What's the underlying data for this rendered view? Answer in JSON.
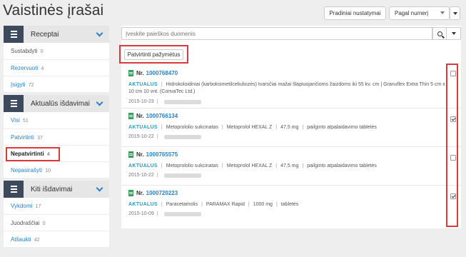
{
  "page": {
    "title": "Vaistinės įrašai"
  },
  "toolbar": {
    "reset_label": "Pradiniai nustatymai",
    "sort_label": "Pagal numerį"
  },
  "search": {
    "placeholder": "Įveskite paieškos duomenis"
  },
  "selected_button": {
    "label": "Patvirtinti pažymėtus"
  },
  "sidebar": {
    "recipes": {
      "title": "Receptai",
      "items": [
        {
          "label": "Sustabdyti",
          "count": "0"
        },
        {
          "label": "Rezervuoti",
          "count": "4"
        },
        {
          "label": "Įsigyti",
          "count": "72"
        }
      ]
    },
    "current": {
      "title": "Aktualūs išdavimai",
      "items": [
        {
          "label": "Visi",
          "count": "51"
        },
        {
          "label": "Patvirtinti",
          "count": "37"
        },
        {
          "label": "Nepatvirtinti",
          "count": "4"
        },
        {
          "label": "Nepasirašyti",
          "count": "10"
        }
      ]
    },
    "other": {
      "title": "Kiti išdavimai",
      "items": [
        {
          "label": "Vykdomi",
          "count": "17"
        },
        {
          "label": "Juodraščiai",
          "count": "0"
        },
        {
          "label": "Atšaukti",
          "count": "42"
        }
      ]
    }
  },
  "records": [
    {
      "nr_label": "Nr.",
      "number": "1000768470",
      "status": "AKTUALUS",
      "details": "Hidrokoloidiniai (karboksimetilceliuliozės) tvarsčiai mažai šlapiuojančioms žaizdoms iki 55 kv. cm   |   Granuflex Extra Thin 5 cm x 10 cm 10 vnt. (ConvaTec Ltd.)",
      "date": "2015-10-23",
      "checked": false
    },
    {
      "nr_label": "Nr.",
      "number": "1000766134",
      "status": "AKTUALUS",
      "details_parts": [
        "Metoprololio sukcinatas",
        "Metoprolol HEXAL Z",
        "47,5 mg",
        "pailginto atpalaidavimo tabletės"
      ],
      "date": "2015-10-22",
      "checked": true
    },
    {
      "nr_label": "Nr.",
      "number": "1000765575",
      "status": "AKTUALUS",
      "details_parts": [
        "Metoprololio sukcinatas",
        "Metoprolol HEXAL Z",
        "47,5 mg",
        "pailginto atpalaidavimo tabletės"
      ],
      "date": "2015-10-22",
      "checked": false
    },
    {
      "nr_label": "Nr.",
      "number": "1000720223",
      "status": "AKTUALUS",
      "details_parts": [
        "Paracetamolis",
        "PARAMAX Rapid",
        "1000 mg",
        "tabletės"
      ],
      "date": "2015-10-09",
      "checked": true
    }
  ],
  "colors": {
    "accent": "#2a7fc6",
    "highlight": "#d83b3b",
    "panel_icon": "#3d4a5c",
    "status": "#2a9bc0"
  }
}
